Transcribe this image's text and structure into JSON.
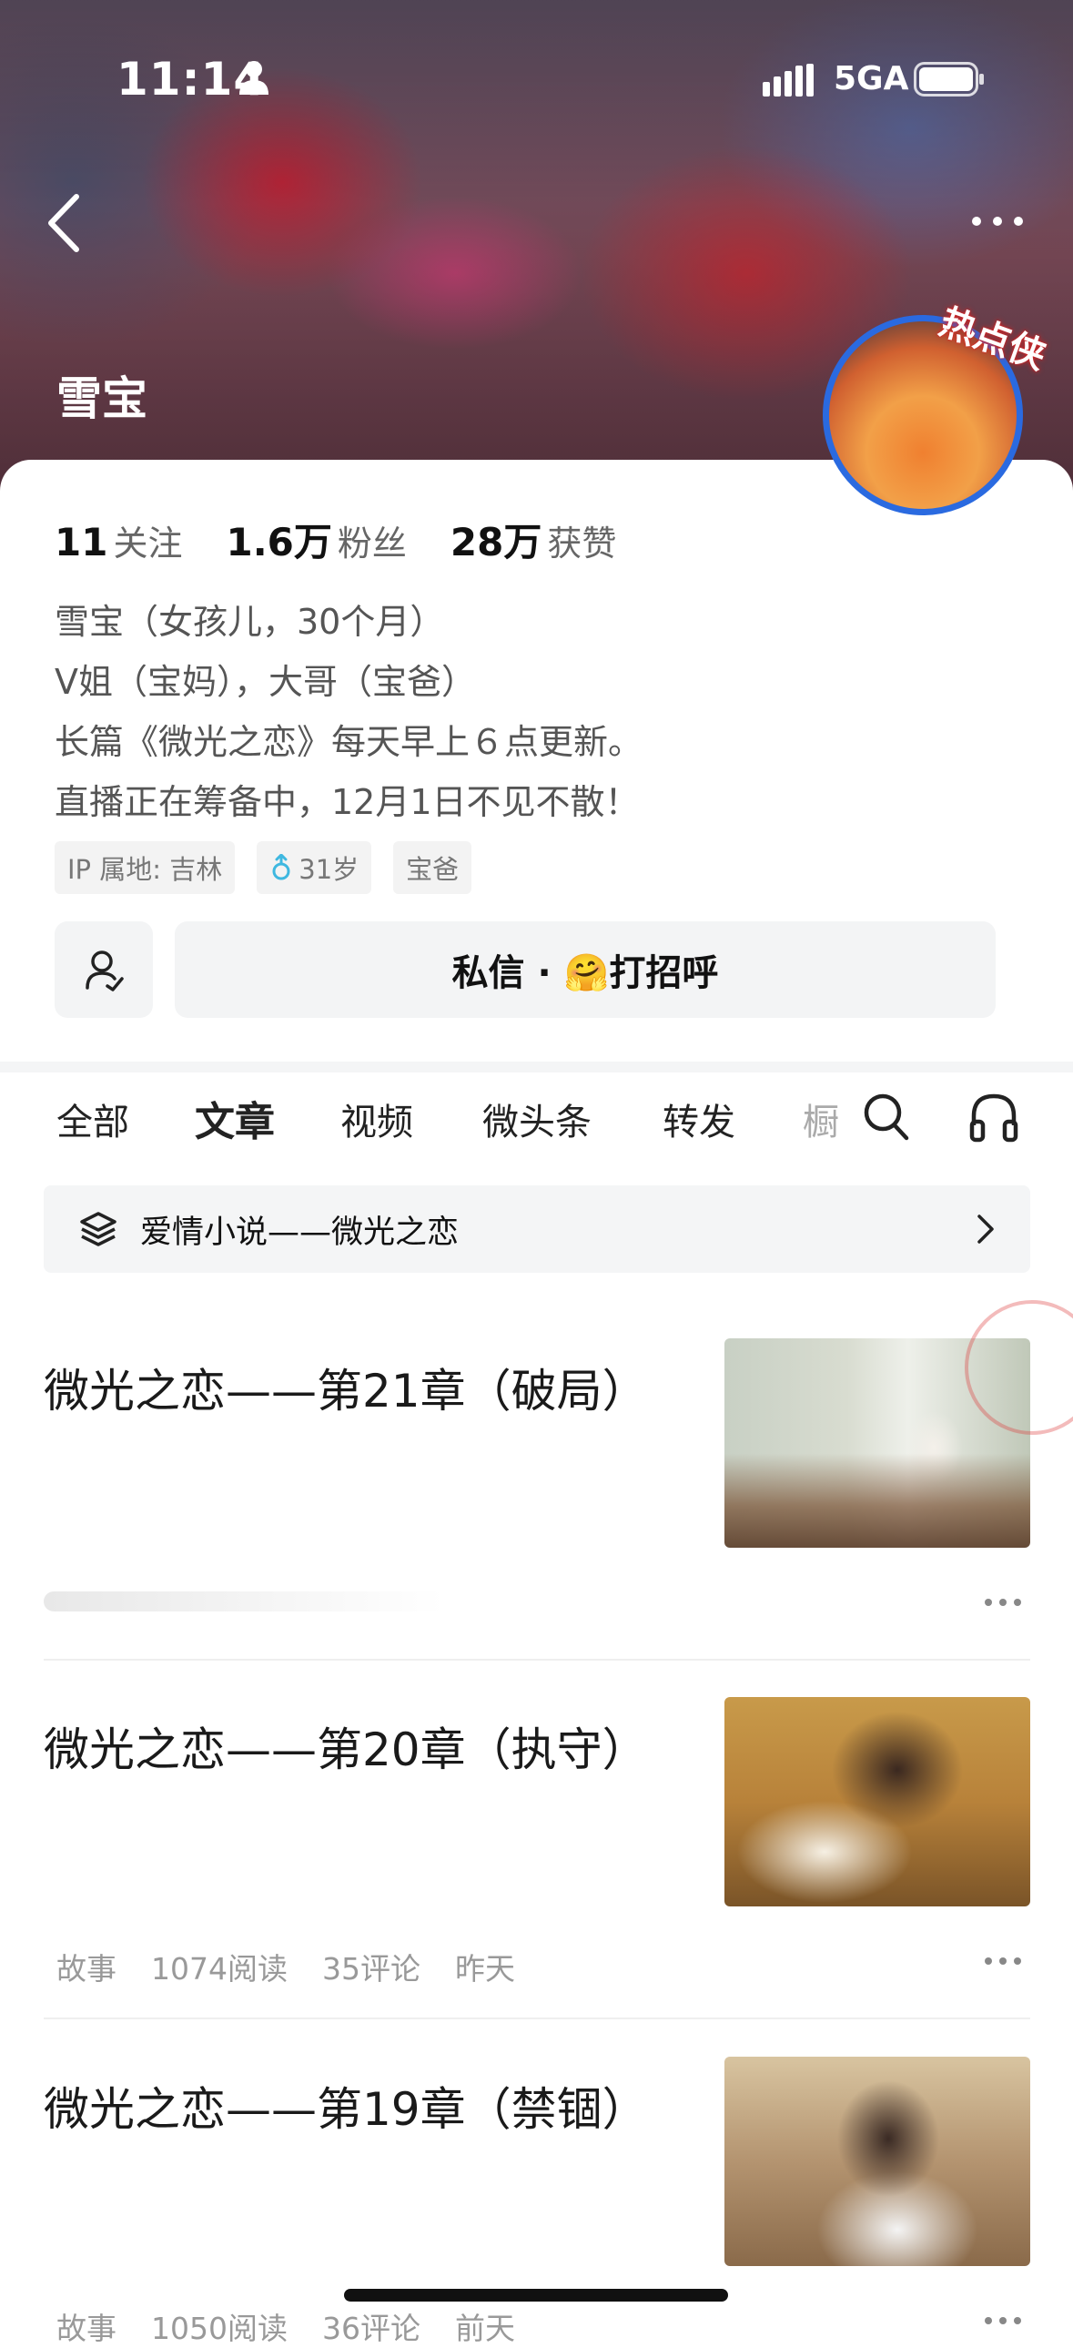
{
  "status_bar": {
    "time": "11:14",
    "network": "5GA"
  },
  "profile": {
    "name": "雪宝",
    "avatar_badge": "热点侠",
    "stats": [
      {
        "num": "11",
        "label": "关注"
      },
      {
        "num": "1.6万",
        "label": "粉丝"
      },
      {
        "num": "28万",
        "label": "获赞"
      }
    ],
    "bio": [
      "雪宝（女孩儿，30个月）",
      "V姐（宝妈），大哥（宝爸）",
      "长篇《微光之恋》每天早上６点更新。",
      "直播正在筹备中，12月1日不见不散！"
    ],
    "tags": [
      "IP 属地: 吉林",
      "31岁",
      "宝爸"
    ],
    "dm_button": "私信 · 🤗打招呼"
  },
  "tabs": [
    "全部",
    "文章",
    "视频",
    "微头条",
    "转发",
    "橱"
  ],
  "active_tab": "文章",
  "collection": {
    "label": "爱情小说——微光之恋"
  },
  "articles": [
    {
      "title": "微光之恋——第21章（破局）",
      "meta": []
    },
    {
      "title": "微光之恋——第20章（执守）",
      "meta": [
        "故事",
        "1074阅读",
        "35评论",
        "昨天"
      ]
    },
    {
      "title": "微光之恋——第19章（禁锢）",
      "meta": [
        "故事",
        "1050阅读",
        "36评论",
        "前天"
      ]
    }
  ],
  "colors": {
    "accent_blue": "#2a6ae0",
    "stamp_red": "#dc3c3c"
  }
}
